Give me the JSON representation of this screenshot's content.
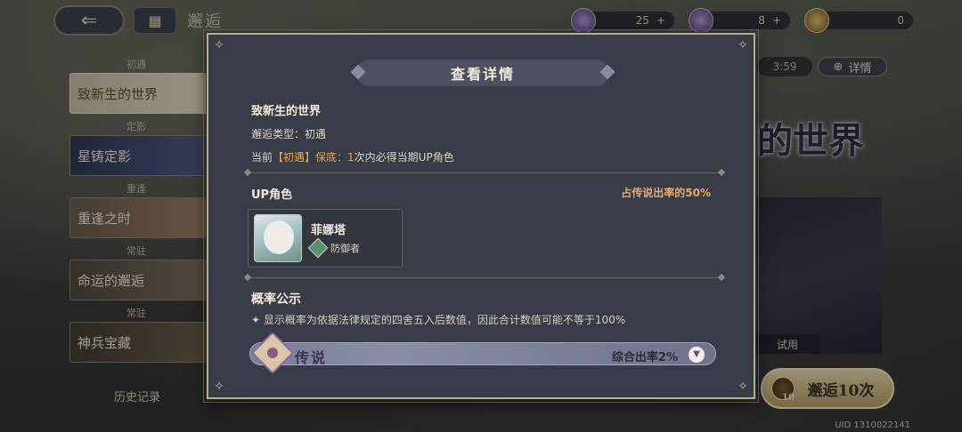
{
  "topbar": {
    "back_glyph": "⇐",
    "home_glyph": "▦",
    "page_title": "邂逅",
    "currencies": [
      {
        "name": "crystal-icon",
        "value": "25",
        "plus": "+"
      },
      {
        "name": "ticket-icon",
        "value": "8",
        "plus": "+"
      },
      {
        "name": "gold-ticket-icon",
        "value": "0"
      }
    ]
  },
  "left_banners": [
    {
      "label": "初遇",
      "title": "致新生的世界",
      "active": true
    },
    {
      "label": "定影",
      "title": "星铸定影"
    },
    {
      "label": "重逢",
      "title": "重逢之时"
    },
    {
      "label": "常驻",
      "title": "命运的邂逅"
    },
    {
      "label": "常驻",
      "title": "神兵宝藏"
    }
  ],
  "history_label": "历史记录",
  "right_panel": {
    "timer": "3:59",
    "detail_label": "详情",
    "world_title": "的世界",
    "trial_label": "试用",
    "pull_label": "邂逅10次",
    "pull_cost": "10",
    "uid": "UID 1310022141"
  },
  "modal": {
    "title": "查看详情",
    "pool_name": "致新生的世界",
    "pool_type": "邂逅类型：初遇",
    "guarantee_prefix": "当前",
    "guarantee_highlight": "【初遇】保底：",
    "guarantee_count": "1",
    "guarantee_suffix": "次内必得当期UP角色",
    "up_heading": "UP角色",
    "up_rate": "占传说出率的50%",
    "character": {
      "name": "菲娜塔",
      "role": "防御者"
    },
    "prob_heading": "概率公示",
    "prob_note": "✦ 显示概率为依据法律规定的四舍五入后数值，因此合计数值可能不等于100%",
    "rarity": {
      "name": "传说",
      "rate": "综合出率2%",
      "expand_glyph": "▼"
    }
  },
  "colors": {
    "modal_bg": "#383b48",
    "modal_border": "#b9ad8a",
    "highlight": "#e9a548",
    "up_rate": "#e9a86b"
  }
}
